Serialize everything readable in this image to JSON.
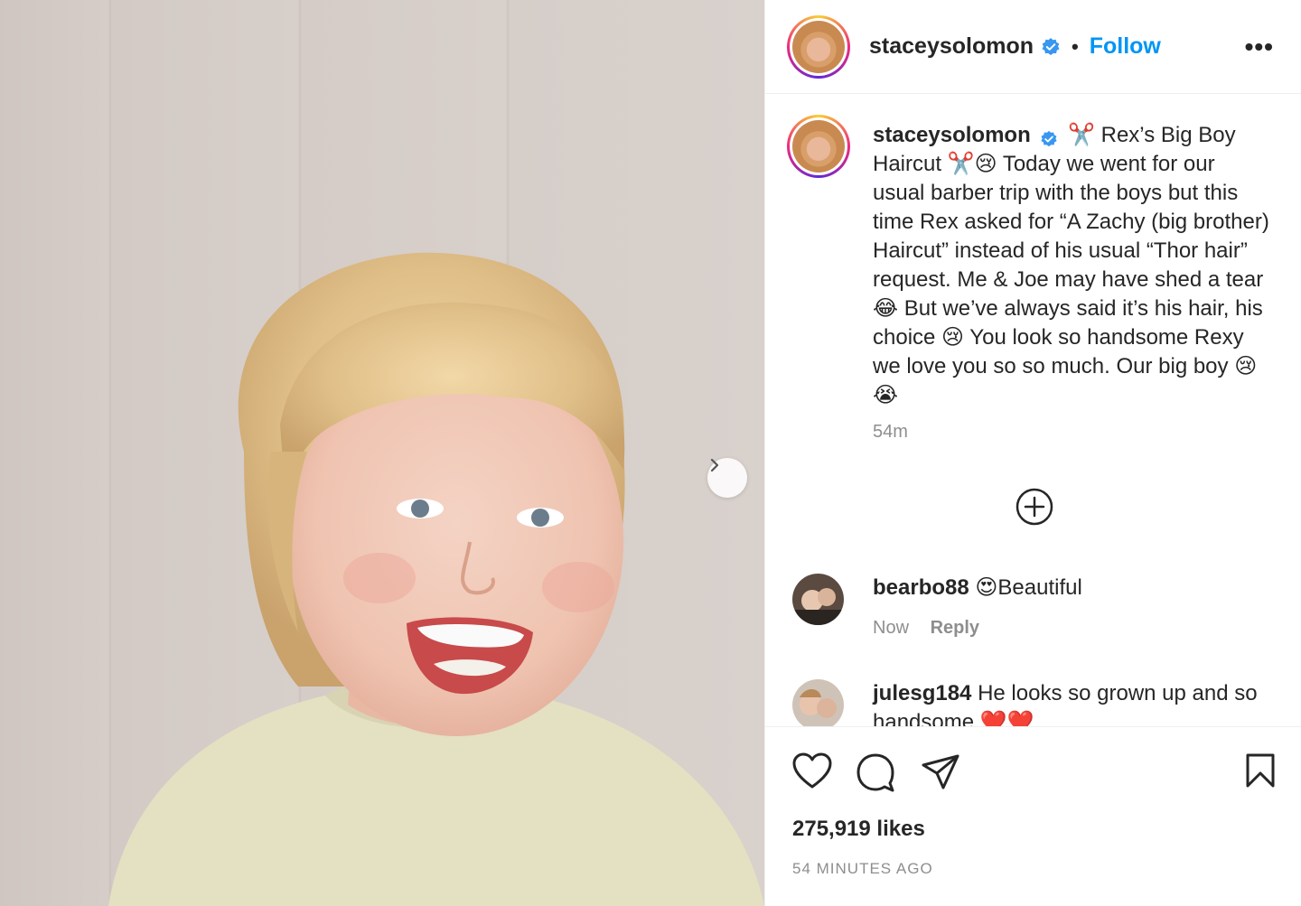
{
  "post": {
    "username": "staceysolomon",
    "separator": "•",
    "follow_label": "Follow",
    "more_label": "•••",
    "caption": "✂️ Rex’s Big Boy Haircut ✂️😢 Today we went for our usual barber trip with the boys but this time Rex asked for “A Zachy (big brother) Haircut” instead of his usual “Thor hair” request. Me & Joe may have shed a tear 😂 But we’ve always said it’s his hair, his choice 😢 You look so handsome Rexy we love you so so much. Our big boy 😢😭",
    "caption_time": "54m",
    "likes": "275,919 likes",
    "posted_ago": "54 MINUTES AGO"
  },
  "comments": [
    {
      "username": "bearbo88",
      "text": "😍Beautiful",
      "time": "Now",
      "reply_label": "Reply"
    },
    {
      "username": "julesg184",
      "text": "He looks so grown up and so handsome ❤️❤️",
      "time": "",
      "reply_label": ""
    }
  ],
  "icons": {
    "verified": "verified-badge-icon",
    "next": "chevron-right-icon",
    "load_more": "plus-circle-icon",
    "like": "heart-icon",
    "comment": "comment-bubble-icon",
    "share": "paper-plane-icon",
    "save": "bookmark-icon"
  },
  "colors": {
    "accent": "#0095f6",
    "text": "#262626",
    "muted": "#8e8e8e",
    "verified": "#3897f0"
  }
}
